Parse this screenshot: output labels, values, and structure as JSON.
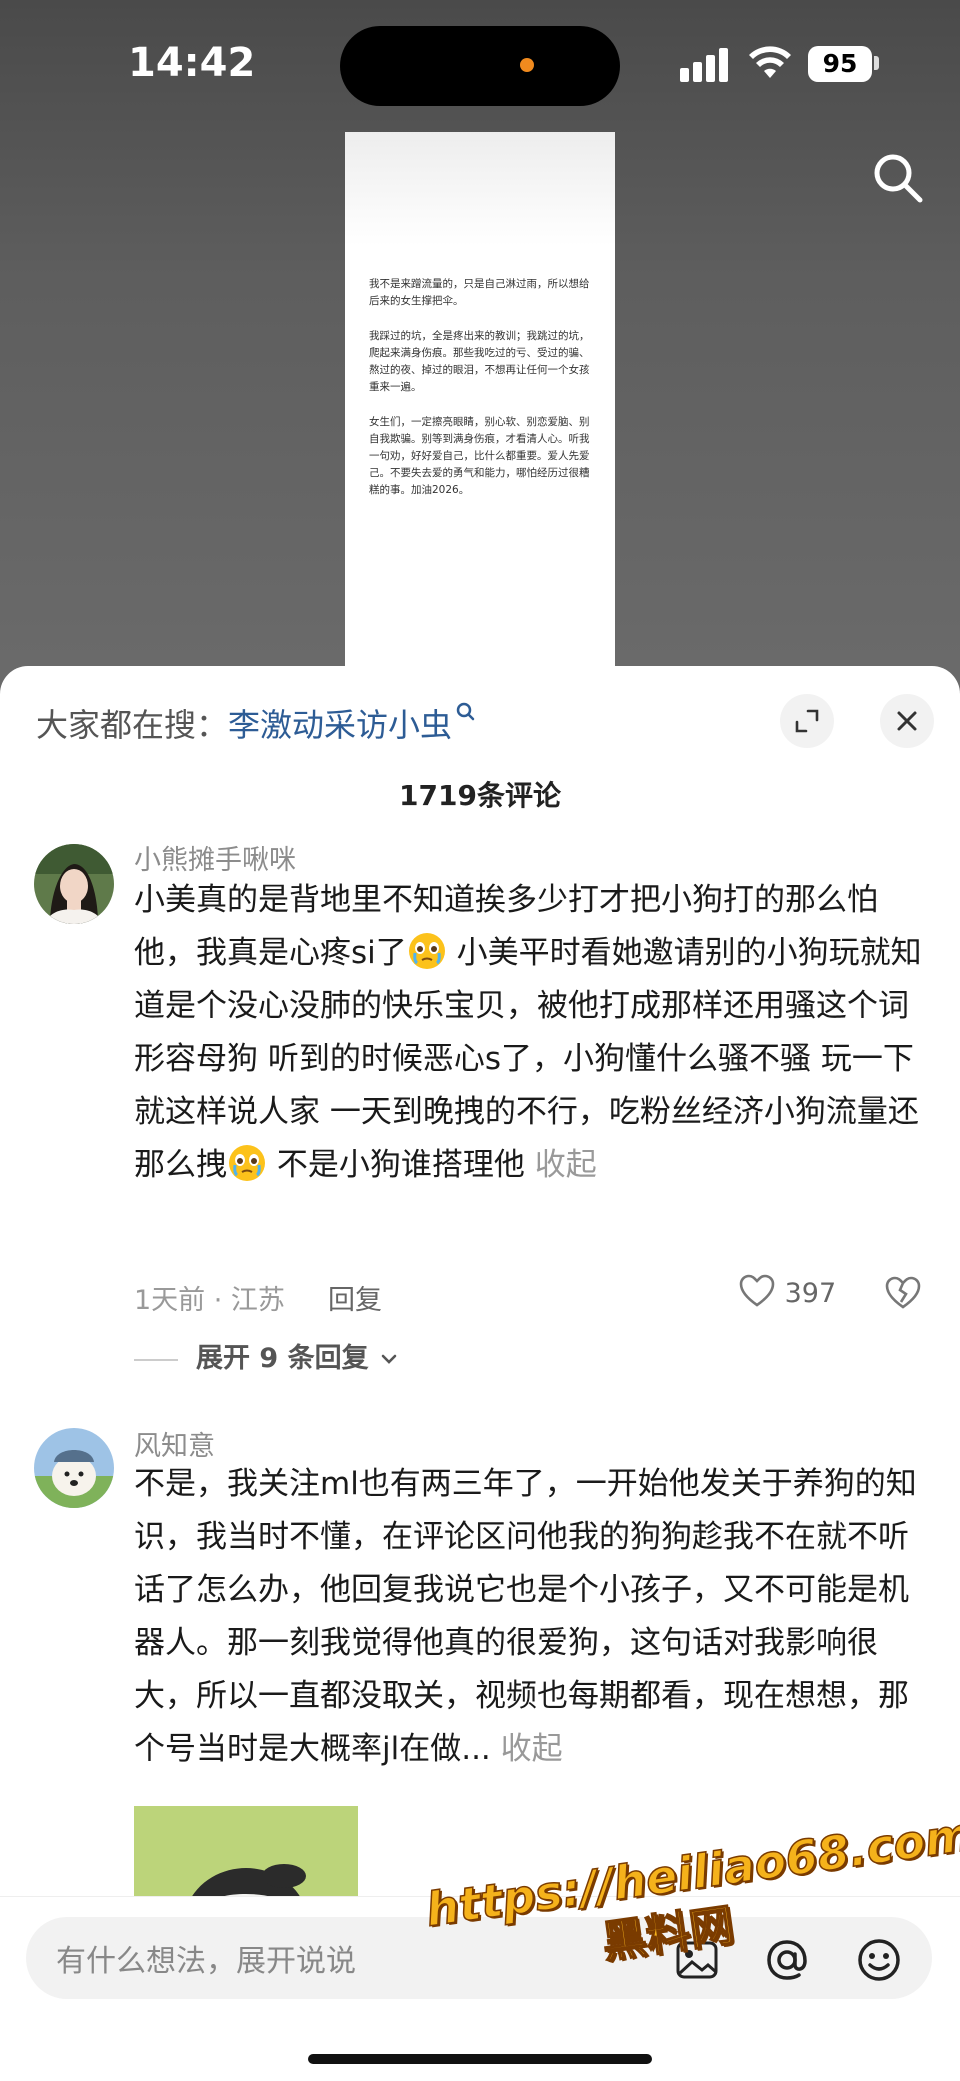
{
  "status_bar": {
    "time": "14:42",
    "battery": "95"
  },
  "video": {
    "doc_paragraphs": [
      "我不是来蹭流量的，只是自己淋过雨，所以想给后来的女生撑把伞。",
      "我踩过的坑，全是疼出来的教训；我跳过的坑，爬起来满身伤痕。那些我吃过的亏、受过的骗、熬过的夜、掉过的眼泪，不想再让任何一个女孩重来一遍。",
      "女生们，一定擦亮眼睛，别心软、别恋爱脑、别自我欺骗。别等到满身伤痕，才看清人心。听我一句劝，好好爱自己，比什么都重要。爱人先爱己。不要失去爱的勇气和能力，哪怕经历过很糟糕的事。加油2026。"
    ]
  },
  "sheet": {
    "search_prefix": "大家都在搜：",
    "search_keyword": "李激动采访小虫",
    "comment_count": "1719条评论"
  },
  "comments": [
    {
      "username": "小熊摊手啾咪",
      "text_part1": "小美真的是背地里不知道挨多少打才把小狗打的那么怕他，我真是心疼si了",
      "text_part2": "  小美平时看她邀请别的小狗玩就知道是个没心没肺的快乐宝贝，被他打成那样还用骚这个词形容母狗  听到的时候恶心s了，小狗懂什么骚不骚  玩一下就这样说人家  一天到晚拽的不行，吃粉丝经济小狗流量还那么拽",
      "text_part3": "  不是小狗谁搭理他 ",
      "collapse": "收起",
      "meta": "1天前 · 江苏",
      "reply_label": "回复",
      "likes": "397",
      "expand_label": "展开 9 条回复"
    },
    {
      "username": "风知意",
      "text": "不是，我关注ml也有两三年了，一开始他发关于养狗的知识，我当时不懂，在评论区问他我的狗狗趁我不在就不听话了怎么办，他回复我说它也是个小孩子，又不可能是机器人。那一刻我觉得他真的很爱狗，这句话对我影响很大，所以一直都没取关，视频也每期都看，现在想想，那个号当时是大概率jl在做... ",
      "collapse": "收起"
    }
  ],
  "input_bar": {
    "placeholder": "有什么想法，展开说说"
  },
  "watermark": {
    "line1": "https://heiliao68.com",
    "line2": "黑料网"
  }
}
